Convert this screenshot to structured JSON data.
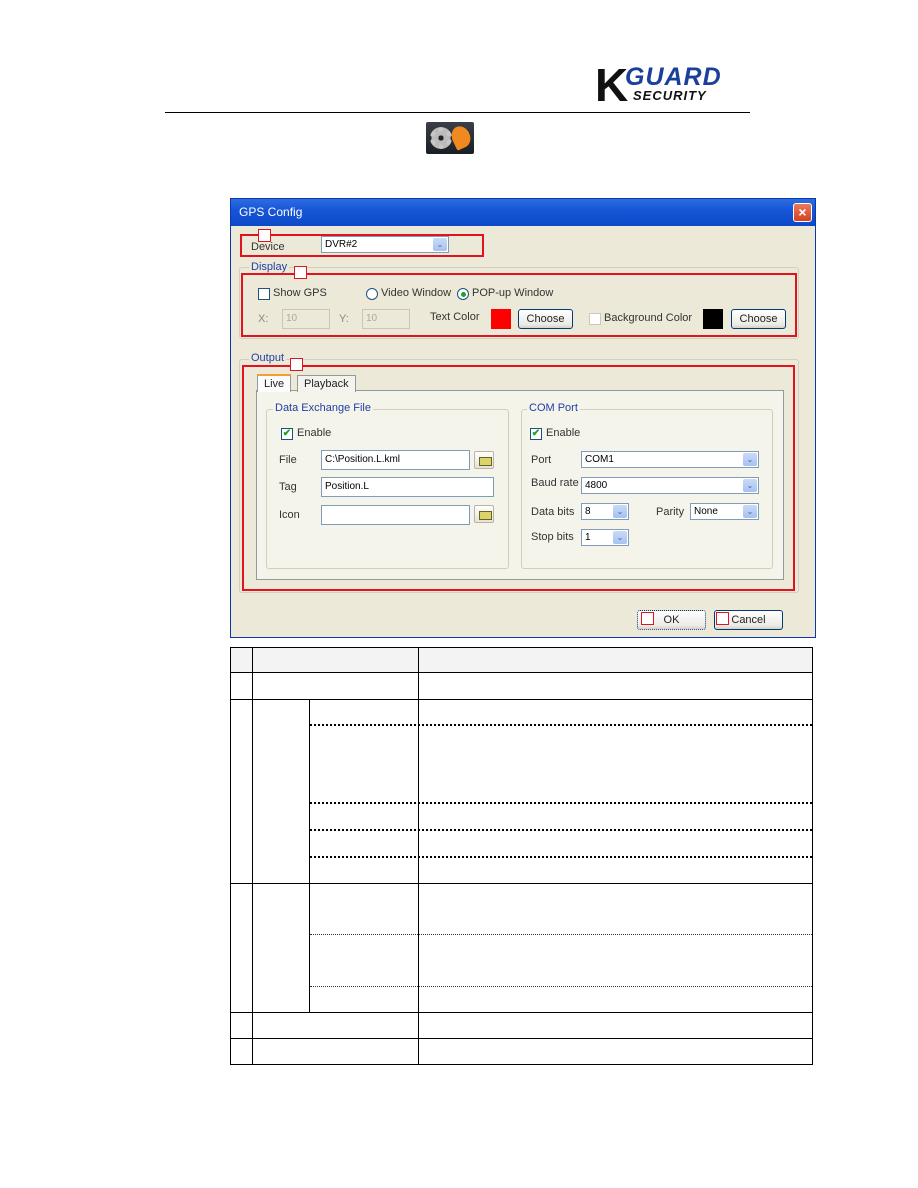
{
  "header": {
    "logo_k": "K",
    "logo_guard": "GUARD",
    "logo_security": "SECURITY",
    "icon": "gps-config-icon"
  },
  "dialog": {
    "title": "GPS Config",
    "close_icon": "×",
    "device": {
      "label": "Device",
      "value": "DVR#2"
    },
    "display": {
      "group_label": "Display",
      "show_gps": {
        "label": "Show GPS",
        "checked": false
      },
      "video_window": {
        "label": "Video Window",
        "selected": false
      },
      "popup_window": {
        "label": "POP-up Window",
        "selected": true
      },
      "x": {
        "label": "X:",
        "value": "10"
      },
      "y": {
        "label": "Y:",
        "value": "10"
      },
      "text_color": {
        "label": "Text Color",
        "color": "#ff0000",
        "button": "Choose"
      },
      "background_color": {
        "label": "Background Color",
        "checked": false,
        "color": "#000000",
        "button": "Choose"
      }
    },
    "output": {
      "group_label": "Output",
      "tabs": [
        {
          "label": "Live",
          "active": true
        },
        {
          "label": "Playback",
          "active": false
        }
      ],
      "data_exchange": {
        "group_label": "Data Exchange File",
        "enable": {
          "label": "Enable",
          "checked": true
        },
        "file": {
          "label": "File",
          "value": "C:\\Position.L.kml"
        },
        "tag": {
          "label": "Tag",
          "value": "Position.L"
        },
        "icon": {
          "label": "Icon",
          "value": ""
        }
      },
      "com_port": {
        "group_label": "COM Port",
        "enable": {
          "label": "Enable",
          "checked": true
        },
        "port": {
          "label": "Port",
          "value": "COM1"
        },
        "baud_rate": {
          "label": "Baud rate",
          "value": "4800"
        },
        "data_bits": {
          "label": "Data bits",
          "value": "8"
        },
        "parity": {
          "label": "Parity",
          "value": "None"
        },
        "stop_bits": {
          "label": "Stop bits",
          "value": "1"
        }
      }
    },
    "ok_button": "OK",
    "cancel_button": "Cancel",
    "check_mark": "✔",
    "dropdown_arrow": "⌄"
  }
}
